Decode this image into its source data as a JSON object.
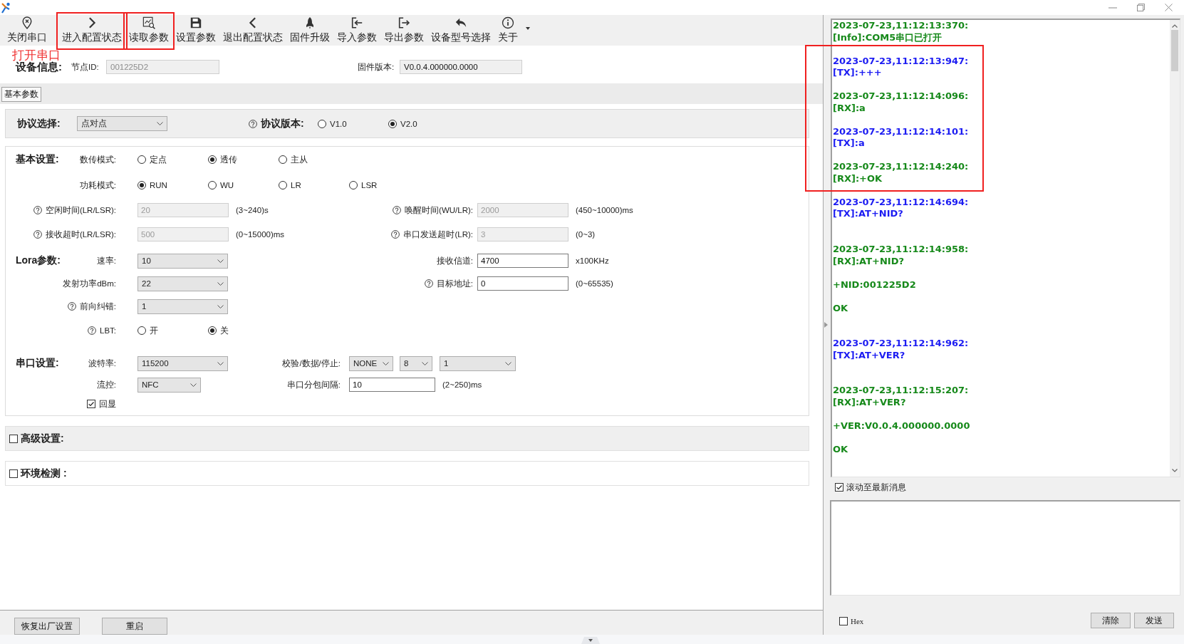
{
  "toolbar": {
    "items": [
      {
        "label": "关闭串口",
        "highlighted": false,
        "note": "打开串口"
      },
      {
        "label": "进入配置状态",
        "highlighted": true
      },
      {
        "label": "读取参数",
        "highlighted": true
      },
      {
        "label": "设置参数",
        "highlighted": false
      },
      {
        "label": "退出配置状态",
        "highlighted": false
      },
      {
        "label": "固件升级",
        "highlighted": false
      },
      {
        "label": "导入参数",
        "highlighted": false
      },
      {
        "label": "导出参数",
        "highlighted": false
      },
      {
        "label": "设备型号选择",
        "highlighted": false
      },
      {
        "label": "关于",
        "highlighted": false
      }
    ]
  },
  "device_info": {
    "title": "设备信息:",
    "fields": [
      {
        "label": "节点ID:",
        "value": "001225D2",
        "disabled": true
      },
      {
        "label": "固件版本:",
        "value": "V0.0.4.000000.0000",
        "disabled": false
      }
    ]
  },
  "tabs": [
    {
      "label": "基本参数",
      "selected": true
    }
  ],
  "protocol": {
    "label": "协议选择:",
    "value": "点对点",
    "version_help": true,
    "version_label": "协议版本:",
    "versions": [
      {
        "label": "V1.0",
        "selected": false
      },
      {
        "label": "V2.0",
        "selected": true
      }
    ]
  },
  "sections": [
    {
      "kind": "wide",
      "title": "基本设置:",
      "rows": [
        {
          "fields": [
            {
              "kind": "radio",
              "label": "数传模式:",
              "help": false,
              "options": [
                {
                  "label": "定点",
                  "selected": false
                },
                {
                  "label": "透传",
                  "selected": true
                },
                {
                  "label": "主从",
                  "selected": false
                }
              ]
            }
          ]
        },
        {
          "fields": [
            {
              "kind": "radio",
              "label": "功耗模式:",
              "help": false,
              "options": [
                {
                  "label": "RUN",
                  "selected": true
                },
                {
                  "label": "WU",
                  "selected": false
                },
                {
                  "label": "LR",
                  "selected": false
                },
                {
                  "label": "LSR",
                  "selected": false
                }
              ]
            }
          ]
        },
        {
          "fields": [
            {
              "kind": "input",
              "label": "空闲时间(LR/LSR):",
              "help": true,
              "value": "20",
              "disabled": true,
              "unit": "(3~240)s"
            },
            {
              "kind": "input",
              "label": "唤醒时间(WU/LR):",
              "help": true,
              "value": "2000",
              "disabled": true,
              "unit": "(450~10000)ms"
            }
          ]
        },
        {
          "fields": [
            {
              "kind": "input",
              "label": "接收超时(LR/LSR):",
              "help": true,
              "value": "500",
              "disabled": true,
              "unit": "(0~15000)ms"
            },
            {
              "kind": "input",
              "label": "串口发送超时(LR):",
              "help": true,
              "value": "3",
              "disabled": true,
              "unit": "(0~3)"
            }
          ]
        }
      ]
    },
    {
      "kind": "wide",
      "title": "Lora参数:",
      "rows": [
        {
          "fields": [
            {
              "kind": "select",
              "label": "速率:",
              "help": false,
              "value": "10"
            },
            {
              "kind": "input",
              "label": "接收信道:",
              "help": false,
              "value": "4700",
              "disabled": false,
              "unit": "x100KHz"
            }
          ]
        },
        {
          "fields": [
            {
              "kind": "select",
              "label": "发射功率dBm:",
              "help": false,
              "value": "22"
            },
            {
              "kind": "input",
              "label": "目标地址:",
              "help": true,
              "value": "0",
              "disabled": false,
              "unit": "(0~65535)"
            }
          ]
        },
        {
          "fields": [
            {
              "kind": "select",
              "label": "前向纠错:",
              "help": true,
              "value": "1"
            }
          ]
        },
        {
          "fields": [
            {
              "kind": "radio",
              "label": "LBT:",
              "help": true,
              "options": [
                {
                  "label": "开",
                  "selected": false
                },
                {
                  "label": "关",
                  "selected": true
                }
              ]
            }
          ]
        }
      ]
    },
    {
      "kind": "compact",
      "title": "串口设置:",
      "rows": [
        {
          "fields": [
            {
              "kind": "select",
              "label": "波特率:",
              "help": false,
              "value": "115200"
            },
            {
              "kind": "selects",
              "label": "校验/数据/停止:",
              "help": false,
              "values": [
                "NONE",
                "8",
                "1"
              ]
            }
          ]
        },
        {
          "fields": [
            {
              "kind": "short-select",
              "label": "流控:",
              "help": false,
              "value": "NFC"
            },
            {
              "kind": "input",
              "label": "串口分包间隔:",
              "help": false,
              "value": "10",
              "disabled": false,
              "unit": "(2~250)ms"
            }
          ]
        },
        {
          "fields": [
            {
              "kind": "checkbox",
              "label": "回显",
              "checked": true
            }
          ]
        }
      ]
    }
  ],
  "collapsibles": [
    {
      "title": "高级设置:",
      "checked": false,
      "hovered": true
    },
    {
      "title": "环境检测 :",
      "checked": false,
      "hovered": false
    }
  ],
  "footer_buttons": [
    "恢复出厂设置",
    "重启"
  ],
  "log": {
    "messages": [
      {
        "kind": "info",
        "timestamp": "2023-07-23,11:12:13:370:",
        "lines": [
          "[Info]:COM5串口已打开"
        ],
        "highlighted": false,
        "trailing_newline": false
      },
      {
        "kind": "tx",
        "timestamp": "2023-07-23,11:12:13:947:",
        "lines": [
          "[TX]:+++"
        ],
        "highlighted": true,
        "trailing_newline": false
      },
      {
        "kind": "rx",
        "timestamp": "2023-07-23,11:12:14:096:",
        "lines": [
          "[RX]:a"
        ],
        "highlighted": true,
        "trailing_newline": false
      },
      {
        "kind": "tx",
        "timestamp": "2023-07-23,11:12:14:101:",
        "lines": [
          "[TX]:a"
        ],
        "highlighted": true,
        "trailing_newline": false
      },
      {
        "kind": "rx",
        "timestamp": "2023-07-23,11:12:14:240:",
        "lines": [
          "[RX]:+OK"
        ],
        "highlighted": true,
        "trailing_newline": false
      },
      {
        "kind": "tx",
        "timestamp": "2023-07-23,11:12:14:694:",
        "lines": [
          "[TX]:AT+NID?"
        ],
        "highlighted": false,
        "trailing_newline": true
      },
      {
        "kind": "rx",
        "timestamp": "2023-07-23,11:12:14:958:",
        "lines": [
          "[RX]:AT+NID?",
          "+NID:001225D2",
          "OK"
        ],
        "highlighted": false,
        "trailing_newline": true
      },
      {
        "kind": "tx",
        "timestamp": "2023-07-23,11:12:14:962:",
        "lines": [
          "[TX]:AT+VER?"
        ],
        "highlighted": false,
        "trailing_newline": true
      },
      {
        "kind": "rx",
        "timestamp": "2023-07-23,11:12:15:207:",
        "lines": [
          "[RX]:AT+VER?",
          "+VER:V0.0.4.000000.0000",
          "OK"
        ],
        "highlighted": false
      }
    ]
  },
  "auto_scroll": {
    "label": "滚动至最新消息",
    "checked": true
  },
  "send": {
    "hex": {
      "label": "Hex",
      "checked": false
    },
    "buttons": [
      "清除",
      "发送"
    ]
  }
}
